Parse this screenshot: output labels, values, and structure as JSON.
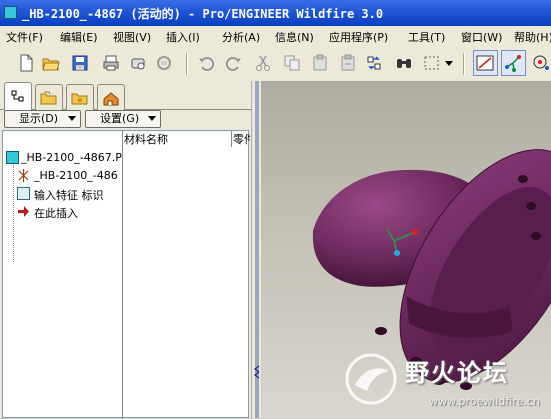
{
  "window": {
    "title": "_HB-2100_-4867 (活动的) - Pro/ENGINEER Wildfire 3.0"
  },
  "menubar": [
    {
      "label": "文件(F)"
    },
    {
      "label": "编辑(E)"
    },
    {
      "label": "视图(V)"
    },
    {
      "label": "插入(I)"
    },
    {
      "label": "分析(A)"
    },
    {
      "label": "信息(N)"
    },
    {
      "label": "应用程序(P)"
    },
    {
      "label": "工具(T)"
    },
    {
      "label": "窗口(W)"
    },
    {
      "label": "帮助(H)"
    }
  ],
  "toolbar_icons": [
    "new-icon",
    "open-icon",
    "save-icon",
    "print-icon",
    "send-icon",
    "mail-icon",
    "undo-icon",
    "redo-icon",
    "cut-icon",
    "copy-icon",
    "paste-icon",
    "paste-special-icon",
    "regenerate-icon",
    "find-icon",
    "select-box-icon",
    "datum-display-icon",
    "datum-axes-icon",
    "spin-center-icon"
  ],
  "navigator": {
    "tabs": [
      "model-tree-tab",
      "folder-tab",
      "favorites-tab",
      "connections-tab"
    ],
    "display_dropdown": "显示(D)",
    "settings_dropdown": "设置(G)",
    "columns": {
      "name": "",
      "material": "材料名称",
      "part": "零件"
    },
    "tree": [
      {
        "label": "_HB-2100_-4867.P",
        "icon": "part-icon"
      },
      {
        "label": "_HB-2100_-486",
        "icon": "coordinate-system-icon"
      },
      {
        "label": "输入特征 标识",
        "icon": "import-feature-icon"
      },
      {
        "label": "在此插入",
        "icon": "insert-here-arrow-icon"
      }
    ]
  },
  "viewport": {
    "model_color": "#6e2a5e",
    "background_top": "#aeaca0",
    "background_bottom": "#d8d6ce"
  },
  "watermark": {
    "text": "野火论坛",
    "url": "www.proewildfire.cn"
  }
}
